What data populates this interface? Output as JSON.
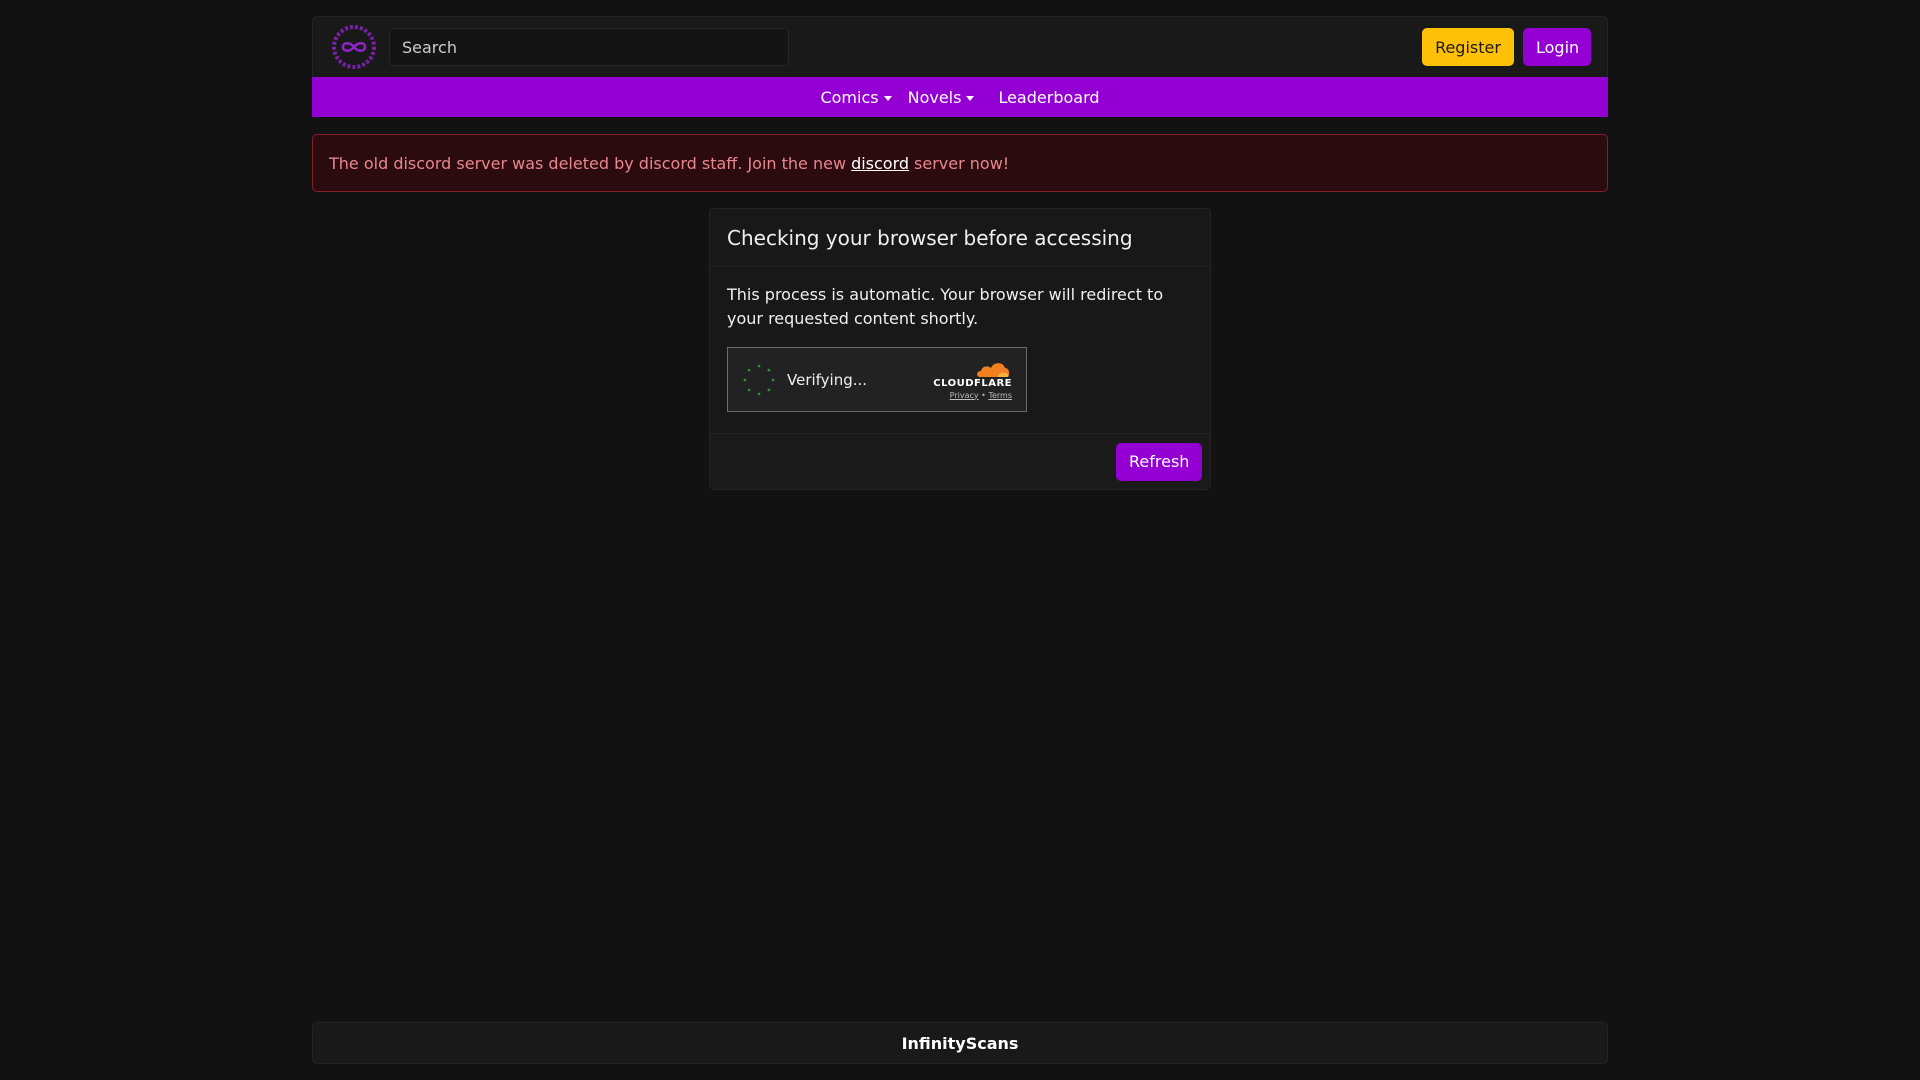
{
  "header": {
    "search_placeholder": "Search",
    "register_label": "Register",
    "login_label": "Login"
  },
  "nav": {
    "comics_label": "Comics",
    "novels_label": "Novels",
    "leaderboard_label": "Leaderboard"
  },
  "alert": {
    "text_before": "The old discord server was deleted by discord staff. Join the new",
    "link_text": "discord",
    "text_after": "server now!"
  },
  "card": {
    "title": "Checking your browser before accessing",
    "body": "This process is automatic. Your browser will redirect to your requested content shortly.",
    "widget": {
      "status": "Verifying...",
      "brand": "CLOUDFLARE",
      "privacy_label": "Privacy",
      "separator": "•",
      "terms_label": "Terms"
    },
    "refresh_label": "Refresh"
  },
  "footer": {
    "site_name": "InfinityScans"
  },
  "colors": {
    "brand_purple": "#9400d3",
    "register_yellow": "#ffc107",
    "alert_bg": "#2c0b0e",
    "alert_text": "#ea868f",
    "cloudflare_orange": "#f38020"
  },
  "icons": {
    "logo": "infinity-scans-logo",
    "spinner": "loading-spinner-icon",
    "cloud": "cloudflare-cloud-icon"
  }
}
